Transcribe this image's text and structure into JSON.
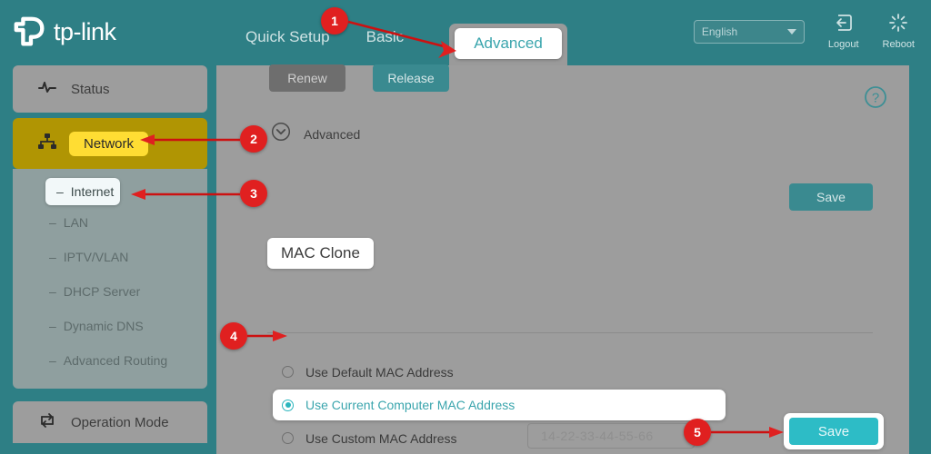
{
  "brand": {
    "name": "tp-link",
    "logo_icon": "tp-link-logo-icon"
  },
  "header": {
    "tabs": [
      {
        "label": "Quick Setup",
        "active": false
      },
      {
        "label": "Basic",
        "active": false
      },
      {
        "label": "Advanced",
        "active": true
      }
    ],
    "language": {
      "value": "English",
      "icon": "chevron-down-icon"
    },
    "logout": {
      "label": "Logout",
      "icon": "logout-icon"
    },
    "reboot": {
      "label": "Reboot",
      "icon": "reboot-icon"
    }
  },
  "sidebar": {
    "status": {
      "label": "Status",
      "icon": "pulse-icon"
    },
    "network": {
      "label": "Network",
      "icon": "network-tree-icon"
    },
    "submenu": [
      {
        "label": "Internet",
        "selected": true
      },
      {
        "label": "LAN",
        "selected": false
      },
      {
        "label": "IPTV/VLAN",
        "selected": false
      },
      {
        "label": "DHCP Server",
        "selected": false
      },
      {
        "label": "Dynamic DNS",
        "selected": false
      },
      {
        "label": "Advanced Routing",
        "selected": false
      }
    ],
    "operation_mode": {
      "label": "Operation Mode",
      "icon": "swap-arrows-icon"
    }
  },
  "content": {
    "renew_button": "Renew",
    "release_button": "Release",
    "help_icon": "question-mark-help-icon",
    "advanced_toggle": {
      "label": "Advanced",
      "icon": "chevron-down-circle-icon"
    },
    "save_top_button": "Save",
    "mac_clone": {
      "title": "MAC Clone",
      "options": [
        {
          "label": "Use Default MAC Address",
          "selected": false
        },
        {
          "label": "Use Current Computer MAC Address",
          "selected": true
        },
        {
          "label": "Use Custom MAC Address",
          "selected": false
        }
      ],
      "custom_mac_placeholder": "14-22-33-44-55-66",
      "custom_mac_value": ""
    },
    "save_bottom_button": "Save"
  },
  "annotations": [
    {
      "number": "1",
      "target": "advanced-tab"
    },
    {
      "number": "2",
      "target": "network-menu"
    },
    {
      "number": "3",
      "target": "internet-submenu"
    },
    {
      "number": "4",
      "target": "use-current-computer-mac-radio"
    },
    {
      "number": "5",
      "target": "save-bottom-button"
    }
  ],
  "colors": {
    "teal": "#2e7f85",
    "gray_overlay": "#9d9d9d",
    "accent_cyan": "#2dbcc6",
    "highlight_yellow": "#ffdd33",
    "annotation_red": "#e02020"
  }
}
